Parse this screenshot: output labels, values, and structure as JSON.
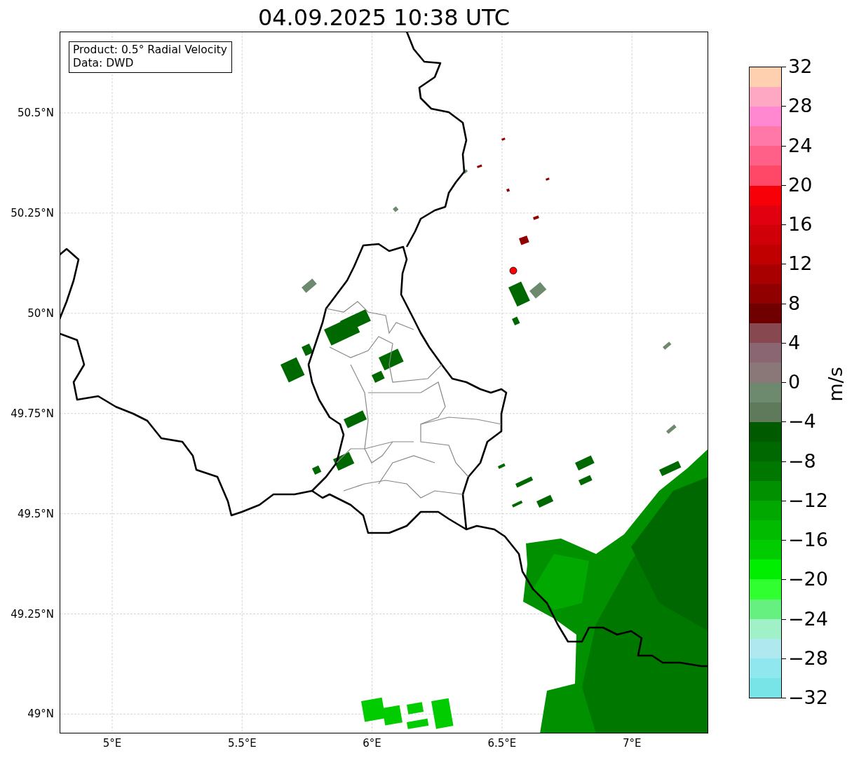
{
  "title": "04.09.2025 10:38 UTC",
  "info_box": [
    "Product: 0.5° Radial Velocity",
    "Data: DWD"
  ],
  "map": {
    "lat_ticks": [
      "50.5°N",
      "50.25°N",
      "50°N",
      "49.75°N",
      "49.5°N",
      "49.25°N",
      "49°N"
    ],
    "lon_ticks": [
      "5°E",
      "5.5°E",
      "6°E",
      "6.5°E",
      "7°E"
    ]
  },
  "colorbar": {
    "label": "m/s",
    "ticks": [
      "32",
      "28",
      "24",
      "20",
      "16",
      "12",
      "8",
      "4",
      "0",
      "−4",
      "−8",
      "−12",
      "−16",
      "−20",
      "−24",
      "−28",
      "−32"
    ],
    "bands": [
      {
        "color": "#ffd0b0"
      },
      {
        "color": "#ffa8c4"
      },
      {
        "color": "#ff88d0"
      },
      {
        "color": "#ff78a8"
      },
      {
        "color": "#ff6088"
      },
      {
        "color": "#ff4868"
      },
      {
        "color": "#f80008"
      },
      {
        "color": "#e00010"
      },
      {
        "color": "#d00008"
      },
      {
        "color": "#c00000"
      },
      {
        "color": "#a80000"
      },
      {
        "color": "#900000"
      },
      {
        "color": "#700000"
      },
      {
        "color": "#884850"
      },
      {
        "color": "#8a6672"
      },
      {
        "color": "#8a7878"
      },
      {
        "color": "#6e8a6e"
      },
      {
        "color": "#5e7a5a"
      },
      {
        "color": "#005a00"
      },
      {
        "color": "#006800"
      },
      {
        "color": "#007800"
      },
      {
        "color": "#009000"
      },
      {
        "color": "#00a800"
      },
      {
        "color": "#00bb00"
      },
      {
        "color": "#00cc00"
      },
      {
        "color": "#00ee00"
      },
      {
        "color": "#30ff30"
      },
      {
        "color": "#66f080"
      },
      {
        "color": "#a0f0c8"
      },
      {
        "color": "#b0e8f0"
      },
      {
        "color": "#90e8ee"
      },
      {
        "color": "#78e4e8"
      }
    ]
  }
}
